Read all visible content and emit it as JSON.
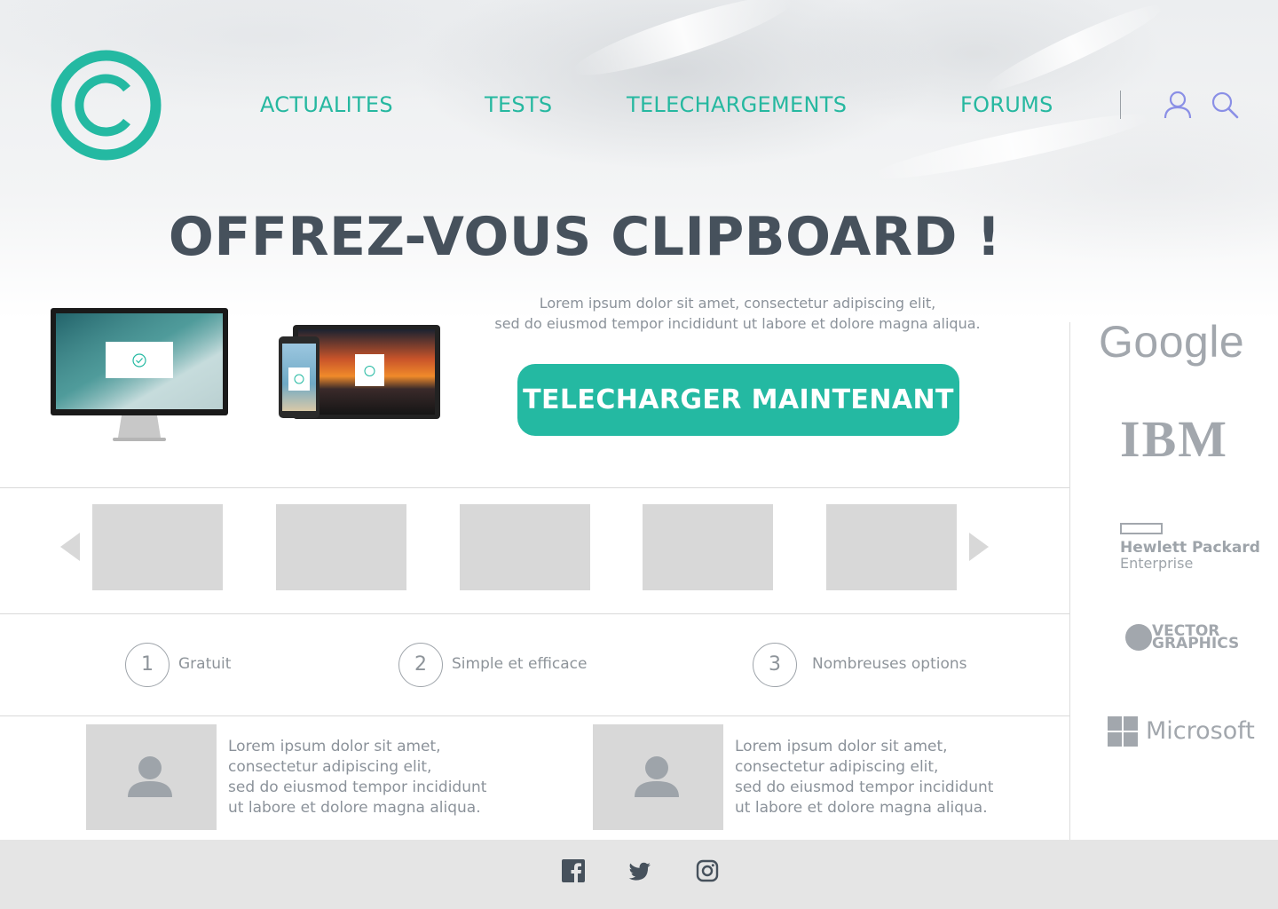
{
  "brand": {
    "logo_icon": "copyright-icon",
    "accent_color": "#24b9a2",
    "text_dark": "#46515c"
  },
  "nav": {
    "items": [
      {
        "label": "ACTUALITES"
      },
      {
        "label": "TESTS"
      },
      {
        "label": "TELECHARGEMENTS"
      },
      {
        "label": "FORUMS"
      }
    ],
    "icons": [
      "user-icon",
      "search-icon"
    ]
  },
  "hero": {
    "title": "OFFREZ-VOUS CLIPBOARD !",
    "text": "Lorem ipsum dolor sit amet, consectetur adipiscing elit,\nsed do eiusmod tempor incididunt ut labore et dolore magna aliqua.",
    "cta_label": "TELECHARGER MAINTENANT"
  },
  "partners": {
    "google": "Google",
    "ibm": "IBM",
    "hpe_line1": "Hewlett Packard",
    "hpe_line2": "Enterprise",
    "vector_line1": "VECTOR",
    "vector_line2": "GRAPHICS",
    "microsoft": "Microsoft"
  },
  "carousel": {
    "prev_icon": "chevron-left-icon",
    "next_icon": "chevron-right-icon",
    "item_count": 5
  },
  "features": [
    {
      "number": "1",
      "label": "Gratuit"
    },
    {
      "number": "2",
      "label": "Simple et efficace"
    },
    {
      "number": "3",
      "label": "Nombreuses options"
    }
  ],
  "testimonials": [
    {
      "text": "Lorem ipsum dolor sit amet,\nconsectetur adipiscing elit,\nsed do eiusmod tempor incididunt\nut labore et dolore magna aliqua."
    },
    {
      "text": "Lorem ipsum dolor sit amet,\nconsectetur adipiscing elit,\nsed do eiusmod tempor incididunt\nut labore et dolore magna aliqua."
    }
  ],
  "footer": {
    "social": [
      "facebook-icon",
      "twitter-icon",
      "instagram-icon"
    ]
  }
}
